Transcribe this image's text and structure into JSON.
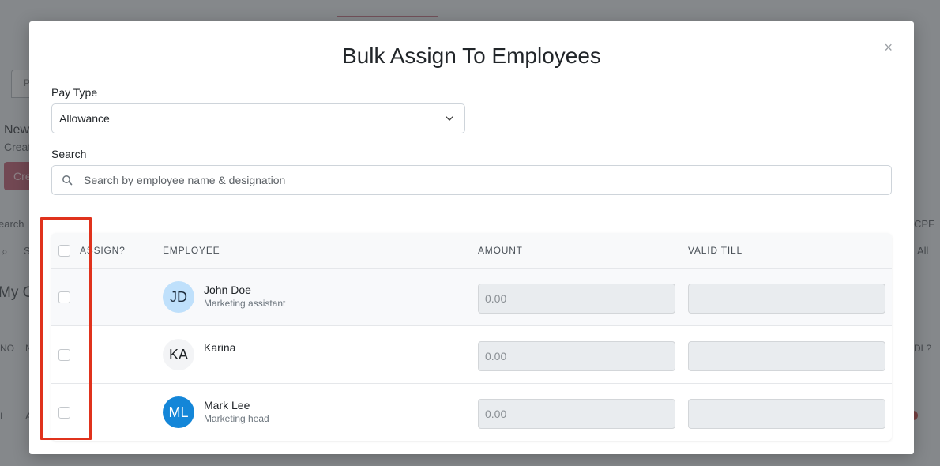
{
  "background": {
    "texts": {
      "new": "New",
      "create": "Creat",
      "create_btn": "Cre",
      "search": "earch",
      "search_field": "S",
      "my": "My Co",
      "no": "NO",
      "n": "N",
      "cpf": "CPF",
      "all": "All",
      "dl": "DL?",
      "p": "P",
      "a": "A"
    }
  },
  "modal": {
    "title": "Bulk Assign To Employees",
    "close_glyph": "×",
    "pay_type": {
      "label": "Pay Type",
      "value": "Allowance"
    },
    "search": {
      "label": "Search",
      "placeholder": "Search by employee name & designation"
    },
    "table": {
      "headers": {
        "assign": "ASSIGN?",
        "employee": "EMPLOYEE",
        "amount": "AMOUNT",
        "valid_till": "VALID TILL"
      },
      "rows": [
        {
          "initials": "JD",
          "name": "John Doe",
          "designation": "Marketing assistant",
          "amount_placeholder": "0.00",
          "avatar_bg": "#bfe0fb",
          "avatar_fg": "#1b2a3a"
        },
        {
          "initials": "KA",
          "name": "Karina",
          "designation": "",
          "amount_placeholder": "0.00",
          "avatar_bg": "#f3f4f6",
          "avatar_fg": "#212529"
        },
        {
          "initials": "ML",
          "name": "Mark Lee",
          "designation": "Marketing head",
          "amount_placeholder": "0.00",
          "avatar_bg": "#1486d8",
          "avatar_fg": "#ffffff"
        }
      ]
    },
    "highlight_color": "#e0321c"
  }
}
